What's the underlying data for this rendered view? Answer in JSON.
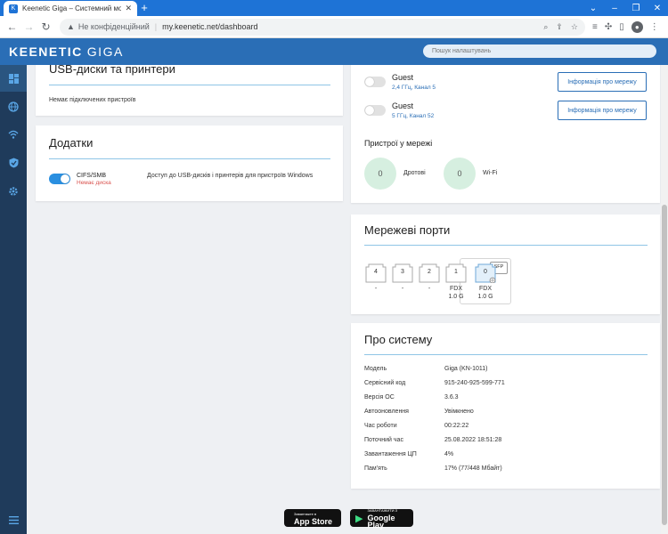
{
  "browser": {
    "tab_title": "Keenetic Giga – Системний мо...",
    "omni_security": "Не конфіденційний",
    "omni_url": "my.keenetic.net/dashboard"
  },
  "app": {
    "brand": "KEENETIC",
    "model": "GIGA",
    "search_placeholder": "Пошук налаштувань"
  },
  "usb": {
    "title": "USB-диски та принтери",
    "empty": "Немає підключених пристроїв"
  },
  "apps": {
    "title": "Додатки",
    "cifs_name": "CIFS/SMB",
    "cifs_status": "Немає диска",
    "cifs_desc": "Доступ до USB-дисків і принтерів для пристроїв Windows",
    "cifs_enabled": true
  },
  "wifi": {
    "networks": [
      {
        "name": "Guest",
        "detail": "2,4 ГГц, Канал 5",
        "button": "Інформація про мережу",
        "enabled": false
      },
      {
        "name": "Guest",
        "detail": "5 ГГц, Канал 52",
        "button": "Інформація про мережу",
        "enabled": false
      }
    ],
    "devices_title": "Пристрої у мережі",
    "wired_count": "0",
    "wired_label": "Дротові",
    "wifi_count": "0",
    "wifi_label": "Wi-Fi"
  },
  "ports": {
    "title": "Мережеві порти",
    "items": [
      {
        "num": "4",
        "line1": "-",
        "line2": ""
      },
      {
        "num": "3",
        "line1": "-",
        "line2": ""
      },
      {
        "num": "2",
        "line1": "-",
        "line2": ""
      },
      {
        "num": "1",
        "line1": "FDX",
        "line2": "1.0 G"
      },
      {
        "num": "0",
        "line1": "FDX",
        "line2": "1.0 G"
      }
    ],
    "sfp_label": "SFP"
  },
  "system": {
    "title": "Про систему",
    "rows": [
      {
        "key": "Модель",
        "value": "Giga (KN-1011)"
      },
      {
        "key": "Сервісний код",
        "value": "915-240-925-599-771"
      },
      {
        "key": "Версія ОС",
        "value": "3.6.3"
      },
      {
        "key": "Автооновлення",
        "value": "Увімкнено"
      },
      {
        "key": "Час роботи",
        "value": "00:22:22"
      },
      {
        "key": "Поточний час",
        "value": "25.08.2022 18:51:28"
      },
      {
        "key": "Завантаження ЦП",
        "value": "4%"
      },
      {
        "key": "Пам'ять",
        "value": "17% (77/448 Мбайт)"
      }
    ]
  },
  "stores": {
    "apple_top": "Завантажте в",
    "apple_main": "App Store",
    "google_top": "ЗАВАНТАЖИТИ З",
    "google_main": "Google Play"
  },
  "colors": {
    "browser_blue": "#1e73d6",
    "header_blue": "#2a6eb6",
    "sidebar": "#1f3b5b",
    "accent_line": "#8fc5e6",
    "toggle_on": "#2a8fe0",
    "device_circle": "#d6efe0"
  }
}
